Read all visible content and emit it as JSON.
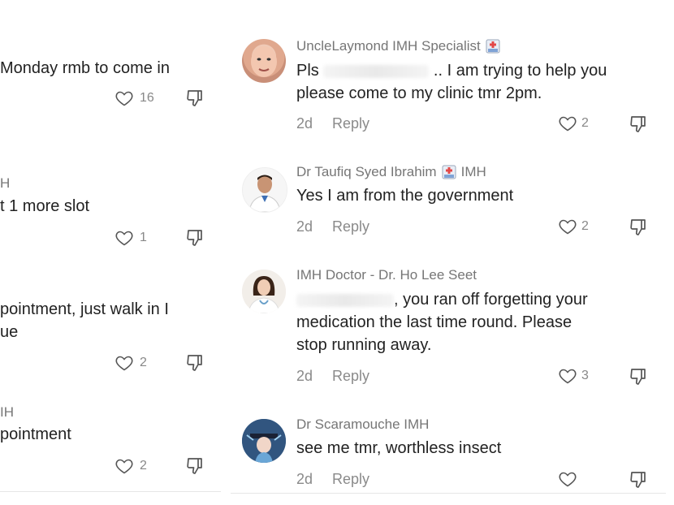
{
  "left": {
    "comments": [
      {
        "username": "",
        "text": "Monday rmb to come in",
        "likes": "16"
      },
      {
        "username": "H",
        "text": "t 1 more slot",
        "likes": "1"
      },
      {
        "username": "",
        "text_lines": [
          "pointment, just walk in I",
          "ue"
        ],
        "likes": "2"
      },
      {
        "username": "IH",
        "text": "pointment",
        "likes": "2"
      }
    ]
  },
  "right": {
    "comments": [
      {
        "username": "UncleLaymond IMH Specialist",
        "text_lines": [
          "Pls",
          ".. I am trying to help you",
          "please come to my clinic tmr 2pm."
        ],
        "time": "2d",
        "reply": "Reply",
        "likes": "2"
      },
      {
        "username_prefix": "Dr Taufiq Syed Ibrahim",
        "username_suffix": "IMH",
        "text": "Yes I am from the government",
        "time": "2d",
        "reply": "Reply",
        "likes": "2"
      },
      {
        "username": "IMH Doctor - Dr. Ho Lee Seet",
        "text_lines": [
          ", you ran off forgetting your",
          "medication the last time round. Please",
          "stop running away."
        ],
        "time": "2d",
        "reply": "Reply",
        "likes": "3"
      },
      {
        "username": "Dr Scaramouche IMH",
        "text": "see me tmr, worthless insect",
        "time": "2d",
        "reply": "Reply",
        "likes": ""
      }
    ]
  },
  "icons": {
    "like": "heart-outline-icon",
    "dislike": "thumb-down-outline-icon",
    "badge": "hospital-badge-icon"
  },
  "colors": {
    "text": "#222222",
    "muted": "#8a8a8a",
    "icon": "#555555"
  }
}
